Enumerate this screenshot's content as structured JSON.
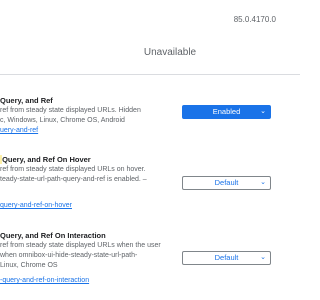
{
  "header": {
    "version": "85.0.4170.0"
  },
  "tabs": {
    "unavailable_label": "Unavailable"
  },
  "experiments": [
    {
      "title": "Query, and Ref",
      "description_lines": [
        "ref from steady state displayed URLs. Hidden",
        "c, Windows, Linux, Chrome OS, Android"
      ],
      "link": "uery-and-ref",
      "selected": "Enabled"
    },
    {
      "title": "Query, and Ref On Hover",
      "description_lines": [
        "ref from steady state displayed URLs on hover.",
        "teady-state-url-path-query-and-ref is enabled. –"
      ],
      "link": "query-and-ref-on-hover",
      "selected": "Default"
    },
    {
      "title": "Query, and Ref On Interaction",
      "description_lines": [
        "ref from steady state displayed URLs when the user",
        "when omnibox-ui-hide-steady-state-url-path-",
        "Linux, Chrome OS"
      ],
      "link": "-query-and-ref-on-interaction",
      "selected": "Default"
    }
  ],
  "icons": {
    "dropdown": "chevron-down-icon"
  },
  "colors": {
    "accent": "#1a73e8",
    "highlight": "#fdf0a8"
  }
}
